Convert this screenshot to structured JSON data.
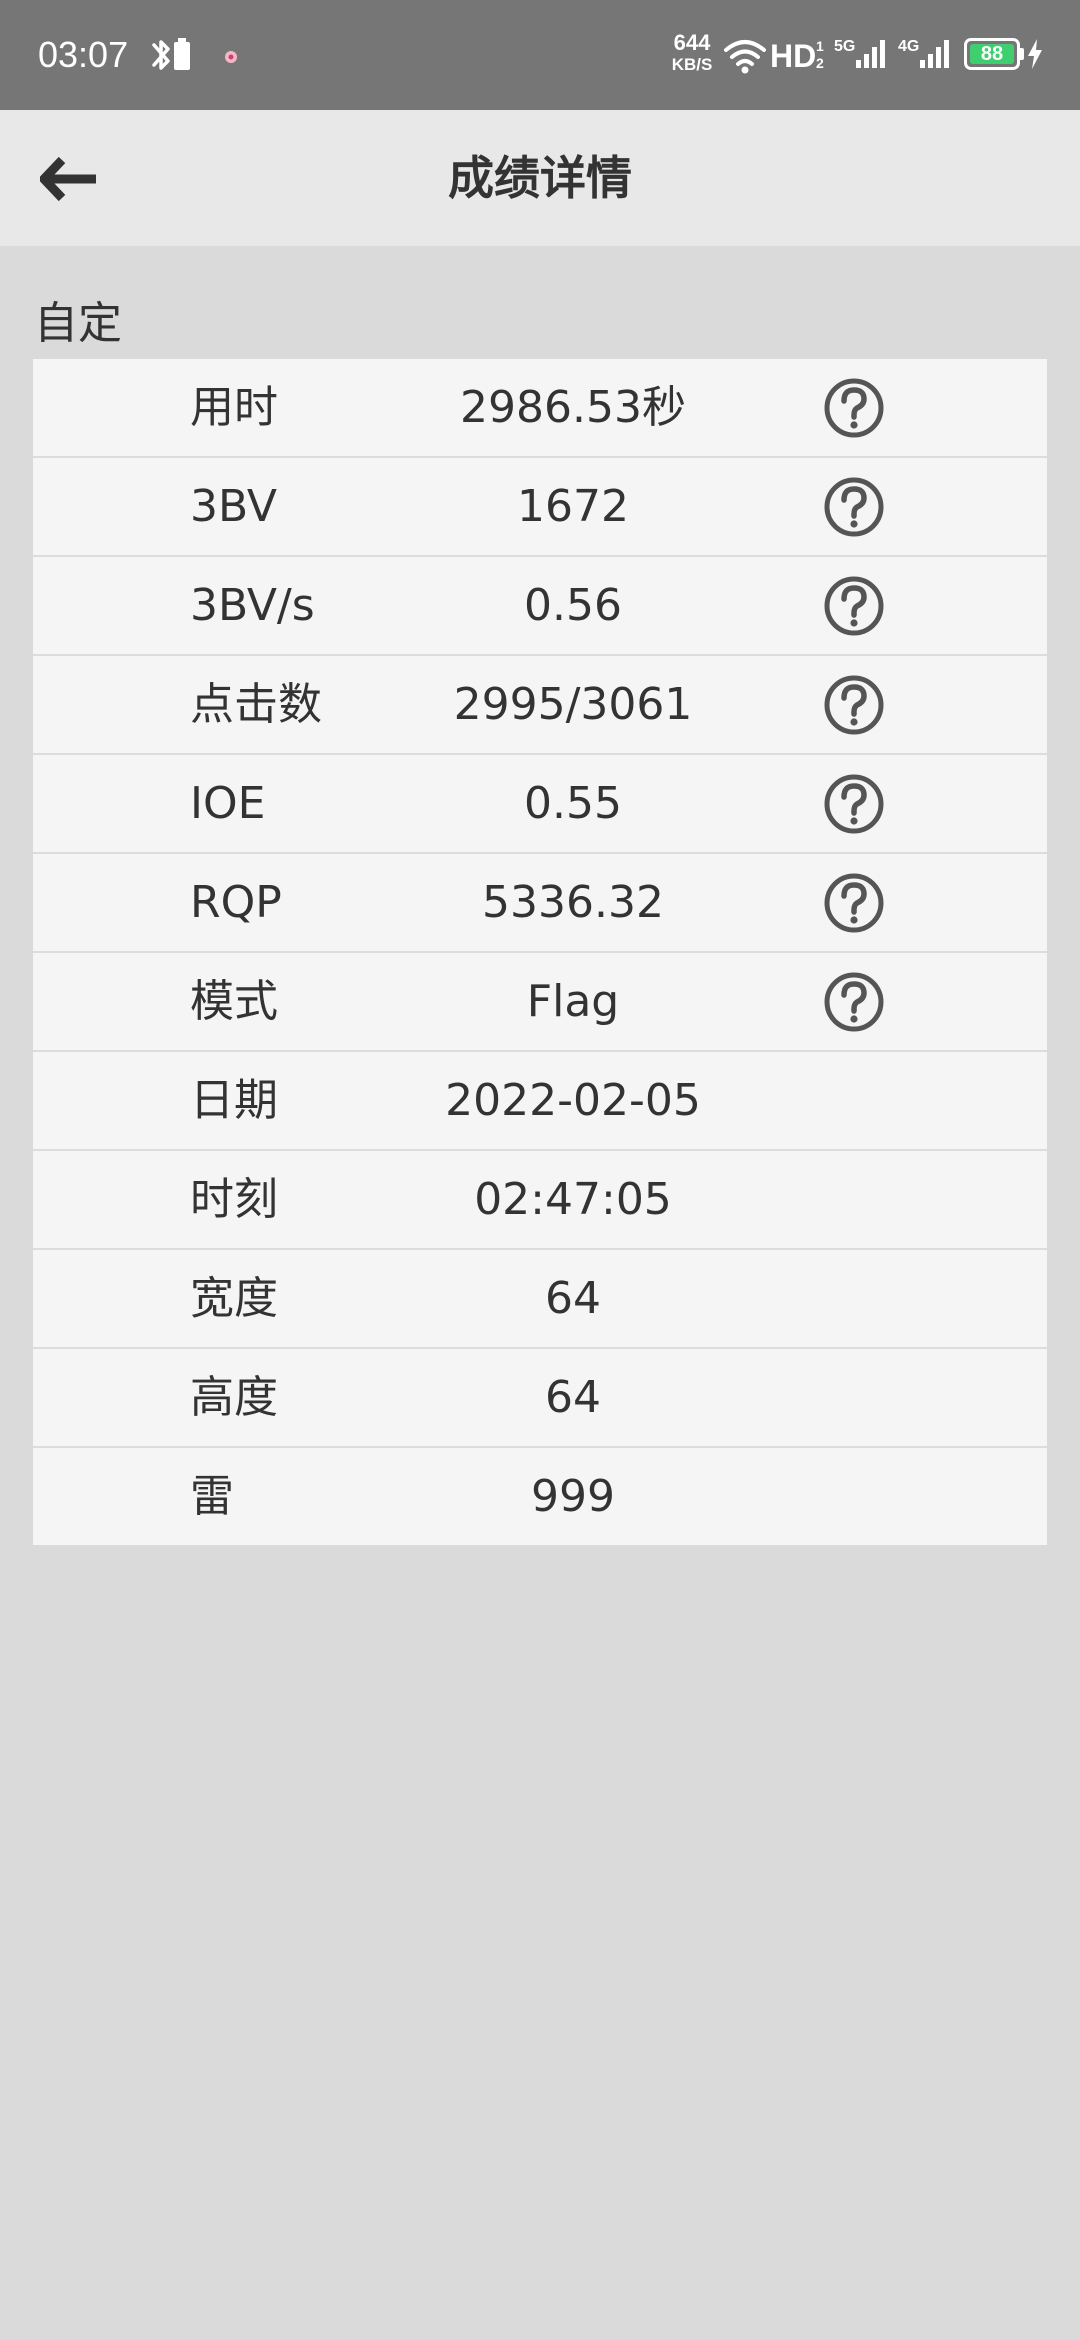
{
  "status_bar": {
    "time": "03:07",
    "net_speed_value": "644",
    "net_speed_unit": "KB/S",
    "hd_label": "HD",
    "hd_superscript": "1",
    "hd_subscript": "2",
    "network_1": "5G",
    "network_2": "4G",
    "battery_level": "88",
    "battery_color": "#3fcf70",
    "icons": [
      "bluetooth-battery-icon",
      "notification-dot-icon",
      "wifi-icon",
      "signal-5g-icon",
      "signal-4g-icon",
      "battery-icon",
      "charging-bolt-icon"
    ]
  },
  "app_bar": {
    "title": "成绩详情",
    "back_icon": "arrow-left-icon"
  },
  "section": {
    "label": "自定"
  },
  "stats": [
    {
      "label": "用时",
      "value": "2986.53秒",
      "has_help": true
    },
    {
      "label": "3BV",
      "value": "1672",
      "has_help": true
    },
    {
      "label": "3BV/s",
      "value": "0.56",
      "has_help": true
    },
    {
      "label": "点击数",
      "value": "2995/3061",
      "has_help": true
    },
    {
      "label": "IOE",
      "value": "0.55",
      "has_help": true
    },
    {
      "label": "RQP",
      "value": "5336.32",
      "has_help": true
    },
    {
      "label": "模式",
      "value": "Flag",
      "has_help": true
    },
    {
      "label": "日期",
      "value": "2022-02-05",
      "has_help": false
    },
    {
      "label": "时刻",
      "value": "02:47:05",
      "has_help": false
    },
    {
      "label": "宽度",
      "value": "64",
      "has_help": false
    },
    {
      "label": "高度",
      "value": "64",
      "has_help": false
    },
    {
      "label": "雷",
      "value": "999",
      "has_help": false
    }
  ],
  "colors": {
    "status_bar_bg": "#767676",
    "app_bar_bg": "#e8e8e8",
    "page_bg": "#dadada",
    "row_bg": "#f5f5f5",
    "text": "#333333",
    "help_icon": "#555555"
  }
}
